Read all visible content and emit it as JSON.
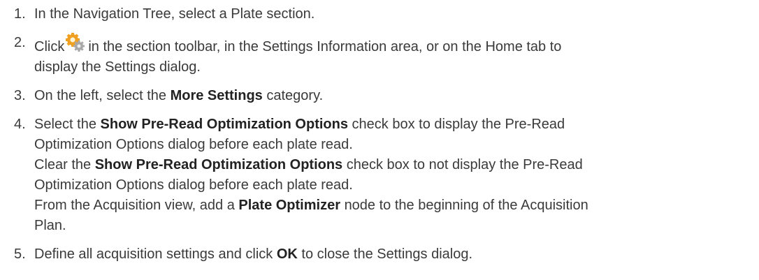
{
  "steps": [
    {
      "num": "1.",
      "text": "In the Navigation Tree, select a Plate section."
    },
    {
      "num": "2.",
      "pre": "Click",
      "icon": "settings-gear-icon",
      "post": "in the section toolbar, in the Settings Information area, or on the Home tab to",
      "cont": "display the Settings dialog."
    },
    {
      "num": "3.",
      "pre": "On the left, select the",
      "bold": "More Settings",
      "post": "category."
    },
    {
      "num": "4.",
      "a_pre": "Select the",
      "a_bold": "Show Pre-Read Optimization Options",
      "a_post": "check box to display the Pre-Read",
      "a_cont": "Optimization Options dialog before each plate read.",
      "b_pre": "Clear the",
      "b_bold": "Show Pre-Read Optimization Options",
      "b_post": "check box to not display the Pre-Read",
      "b_cont": "Optimization Options dialog before each plate read.",
      "c_pre": "From the Acquisition view, add a",
      "c_bold": "Plate Optimizer",
      "c_post": "node to the beginning of the Acquisition",
      "c_cont": "Plan."
    },
    {
      "num": "5.",
      "pre": "Define all acquisition settings and click",
      "bold": "OK",
      "post": "to close the Settings dialog."
    }
  ],
  "colors": {
    "text": "#3a3a3a",
    "icon_orange": "#f0a020",
    "icon_gray": "#9a9a9a"
  }
}
